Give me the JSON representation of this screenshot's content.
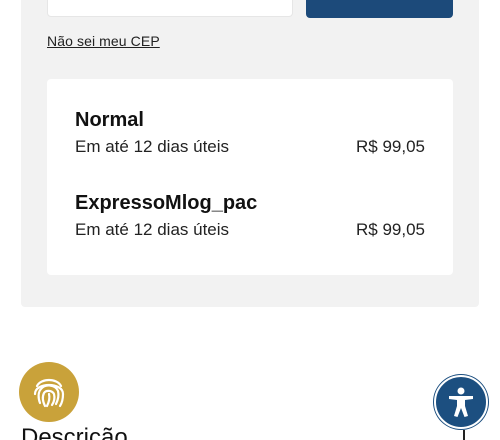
{
  "shipping": {
    "cep_link": "Não sei meu CEP",
    "options": [
      {
        "name": "Normal",
        "delivery": "Em até 12 dias úteis",
        "price": "R$ 99,05"
      },
      {
        "name": "ExpressoMlog_pac",
        "delivery": "Em até 12 dias úteis",
        "price": "R$ 99,05"
      }
    ]
  },
  "section": {
    "title": "Descrição"
  },
  "colors": {
    "primary": "#1c4a7a",
    "fingerprint": "#c9a23a",
    "panel_bg": "#f2f2f2"
  },
  "icons": {
    "fingerprint": "fingerprint-icon",
    "accessibility": "accessibility-icon",
    "expand": "plus-icon"
  }
}
